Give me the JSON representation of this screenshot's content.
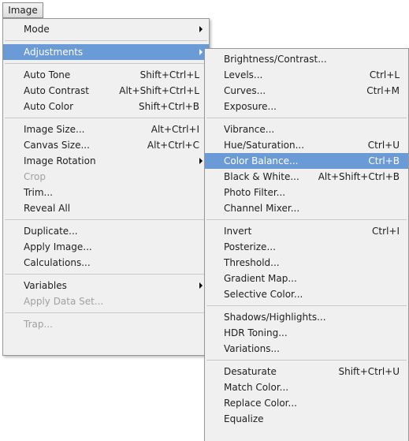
{
  "menubar": {
    "title": "Image"
  },
  "main_menu": {
    "mode": "Mode",
    "adjustments": "Adjustments",
    "auto_tone": {
      "label": "Auto Tone",
      "shortcut": "Shift+Ctrl+L"
    },
    "auto_contrast": {
      "label": "Auto Contrast",
      "shortcut": "Alt+Shift+Ctrl+L"
    },
    "auto_color": {
      "label": "Auto Color",
      "shortcut": "Shift+Ctrl+B"
    },
    "image_size": {
      "label": "Image Size...",
      "shortcut": "Alt+Ctrl+I"
    },
    "canvas_size": {
      "label": "Canvas Size...",
      "shortcut": "Alt+Ctrl+C"
    },
    "image_rotation": "Image Rotation",
    "crop": "Crop",
    "trim": "Trim...",
    "reveal_all": "Reveal All",
    "duplicate": "Duplicate...",
    "apply_image": "Apply Image...",
    "calculations": "Calculations...",
    "variables": "Variables",
    "apply_data_set": "Apply Data Set...",
    "trap": "Trap..."
  },
  "adjustments_menu": {
    "brightness_contrast": "Brightness/Contrast...",
    "levels": {
      "label": "Levels...",
      "shortcut": "Ctrl+L"
    },
    "curves": {
      "label": "Curves...",
      "shortcut": "Ctrl+M"
    },
    "exposure": "Exposure...",
    "vibrance": "Vibrance...",
    "hue_saturation": {
      "label": "Hue/Saturation...",
      "shortcut": "Ctrl+U"
    },
    "color_balance": {
      "label": "Color Balance...",
      "shortcut": "Ctrl+B"
    },
    "black_white": {
      "label": "Black & White...",
      "shortcut": "Alt+Shift+Ctrl+B"
    },
    "photo_filter": "Photo Filter...",
    "channel_mixer": "Channel Mixer...",
    "invert": {
      "label": "Invert",
      "shortcut": "Ctrl+I"
    },
    "posterize": "Posterize...",
    "threshold": "Threshold...",
    "gradient_map": "Gradient Map...",
    "selective_color": "Selective Color...",
    "shadows_highlights": "Shadows/Highlights...",
    "hdr_toning": "HDR Toning...",
    "variations": "Variations...",
    "desaturate": {
      "label": "Desaturate",
      "shortcut": "Shift+Ctrl+U"
    },
    "match_color": "Match Color...",
    "replace_color": "Replace Color...",
    "equalize": "Equalize"
  },
  "colors": {
    "highlight": "#6b9bd6",
    "menu_background": "#f0f0f0",
    "disabled_text": "#a0a0a0"
  }
}
